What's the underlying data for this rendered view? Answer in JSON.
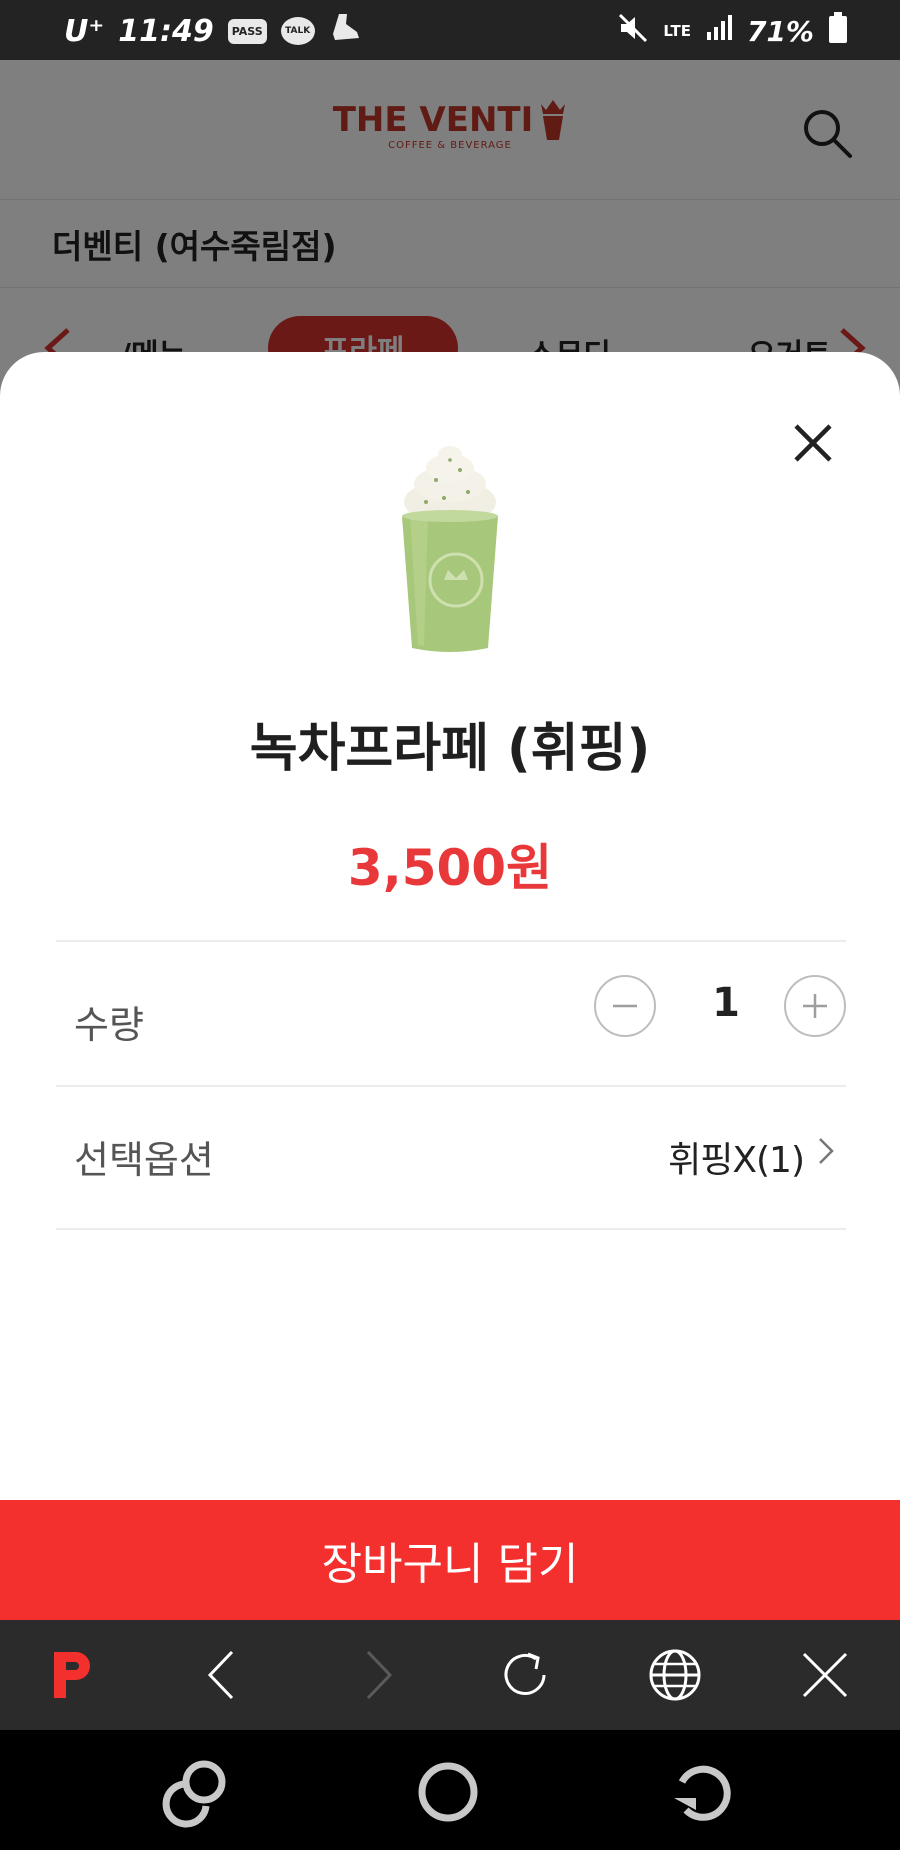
{
  "status_bar": {
    "carrier": "U⁺",
    "time": "11:49",
    "pass_badge": "PASS",
    "talk_badge": "TALK",
    "network": "LTE",
    "battery": "71%"
  },
  "background_page": {
    "logo_main": "THE VENTI",
    "logo_sub": "COFFEE & BEVERAGE",
    "store_name": "더벤티 (여수죽림점)",
    "categories": [
      "/메뉴",
      "프라페",
      "스무디",
      "요거트"
    ]
  },
  "modal": {
    "product_name": "녹차프라페 (휘핑)",
    "price": "3,500원",
    "quantity_label": "수량",
    "quantity_value": "1",
    "option_label": "선택옵션",
    "option_value": "휘핑X(1)",
    "cart_button": "장바구니 담기"
  },
  "colors": {
    "accent": "#f4302f",
    "price": "#e8383a",
    "brand": "#c2362b"
  },
  "icons": {
    "close": "close-icon",
    "minus": "minus-icon",
    "plus": "plus-icon",
    "chevron": "chevron-right-icon",
    "search": "search-icon"
  }
}
